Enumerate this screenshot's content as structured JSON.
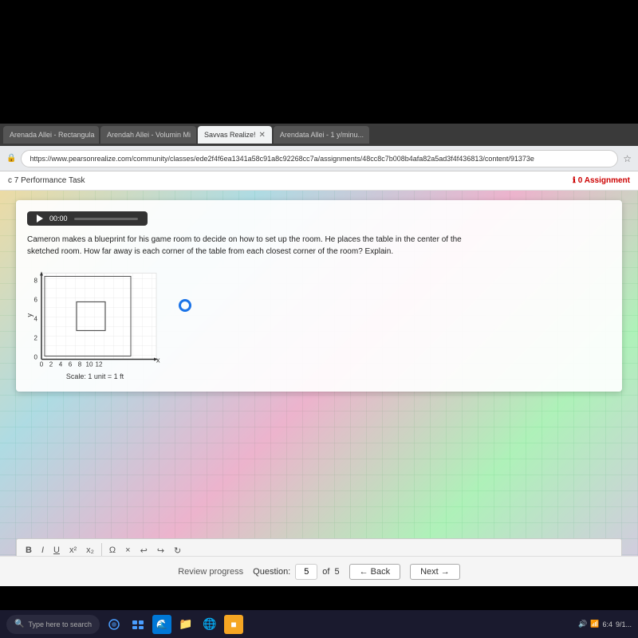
{
  "browser": {
    "tabs": [
      {
        "label": "Arenada Allei - Rectangula",
        "active": false
      },
      {
        "label": "Arendah Allei - Volumin Mi",
        "active": false
      },
      {
        "label": "Savvas Realize!",
        "active": true
      },
      {
        "label": "Arendata Allei - 1 y/minu...",
        "active": false
      }
    ],
    "url": "https://www.pearsonrealize.com/community/classes/ede2f4f6ea1341a58c91a8c92268cc7a/assignments/48cc8c7b008b4afa82a5ad3f4f436813/content/91373e",
    "page_title": "c 7 Performance Task",
    "assignment_label": "0 Assignment"
  },
  "content": {
    "video": {
      "time": "00:00"
    },
    "question": "Cameron makes a blueprint for his game room to decide on how to set up the room. He places the table in the center of the sketched room. How far away is each corner of the table from each closest corner of the room? Explain.",
    "graph": {
      "scale_label": "Scale: 1 unit = 1 ft",
      "y_axis_labels": [
        "8",
        "6",
        "4",
        "2",
        "0"
      ],
      "x_axis_labels": [
        "0",
        "2",
        "4",
        "6",
        "8",
        "10",
        "12"
      ]
    },
    "toolbar": {
      "buttons": [
        "B",
        "I",
        "U",
        "x²",
        "x₂",
        "Ω",
        "×",
        "↩",
        "↪",
        "↻"
      ]
    }
  },
  "bottom_nav": {
    "review_label": "Review progress",
    "question_label": "Question:",
    "current_question": "5",
    "total_questions": "5",
    "back_label": "← Back",
    "next_label": "Next →"
  },
  "taskbar": {
    "search_placeholder": "Type here to search",
    "time": "6:4",
    "date": "9/1..."
  }
}
